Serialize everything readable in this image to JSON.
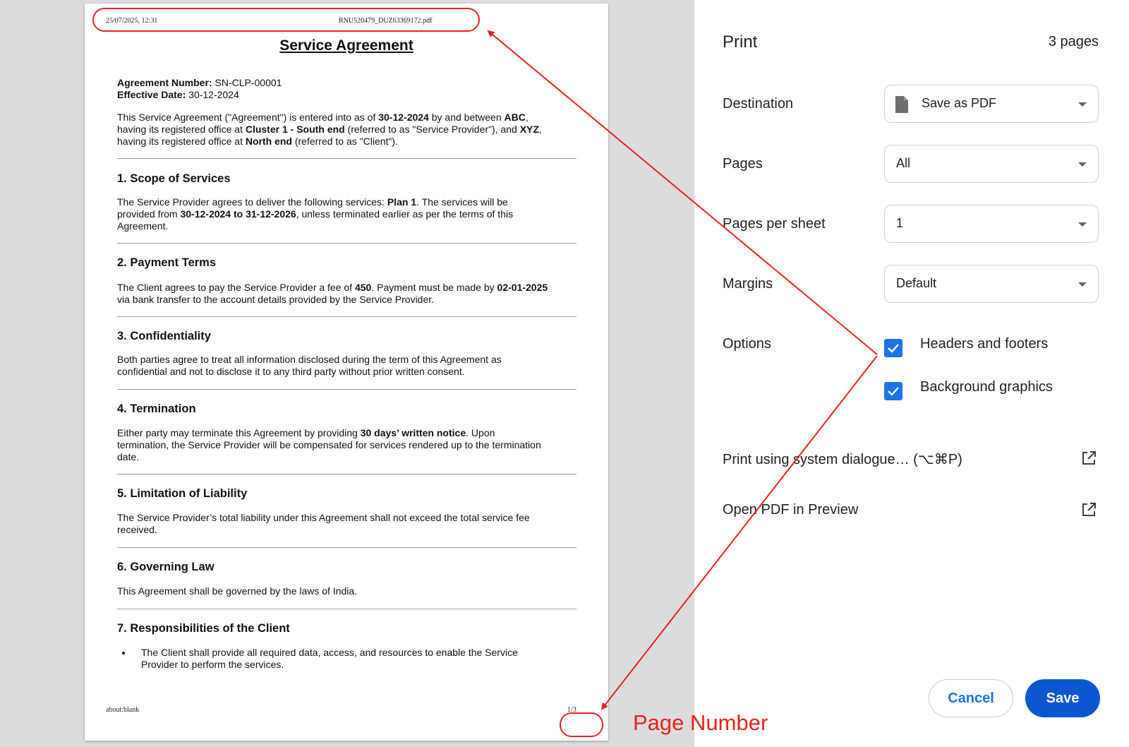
{
  "preview": {
    "header_date": "25/07/2025, 12:31",
    "header_file": "RNU520479_DUZ63369172.pdf",
    "footer_url": "about:blank",
    "footer_page": "1/3",
    "title": "Service Agreement",
    "agreement_number_label": "Agreement Number:",
    "agreement_number": "SN-CLP-00001",
    "effective_date_label": "Effective Date:",
    "effective_date": "30-12-2024",
    "intro": {
      "t1": "This Service Agreement (\"Agreement\") is entered into as of ",
      "b1": "30-12-2024",
      "t2": " by and between ",
      "b2": "ABC",
      "t3": ",",
      "t4": "having its registered office at ",
      "b3": "Cluster 1 - South end",
      "t5": " (referred to as \"Service Provider\"), and ",
      "b4": "XYZ",
      "t6": ",",
      "t7": "having its registered office at ",
      "b5": "North end",
      "t8": " (referred to as \"Client\")."
    },
    "sections": {
      "s1": {
        "heading": "1. Scope of Services",
        "t1": "The Service Provider agrees to deliver the following services: ",
        "b1": "Plan 1",
        "t2": ". The services will be",
        "t3": "provided from ",
        "b2": "30-12-2024 to 31-12-2026",
        "t4": ", unless terminated earlier as per the terms of this",
        "t5": "Agreement."
      },
      "s2": {
        "heading": "2. Payment Terms",
        "t1": "The Client agrees to pay the Service Provider a fee of ",
        "b1": "450",
        "t2": ". Payment must be made by ",
        "b2": "02-01-2025",
        "t3": "via bank transfer to the account details provided by the Service Provider."
      },
      "s3": {
        "heading": "3. Confidentiality",
        "line1": "Both parties agree to treat all information disclosed during the term of this Agreement as",
        "line2": "confidential and not to disclose it to any third party without prior written consent."
      },
      "s4": {
        "heading": "4. Termination",
        "t1": "Either party may terminate this Agreement by providing ",
        "b1": "30 days’ written notice",
        "t2": ". Upon",
        "line2": "termination, the Service Provider will be compensated for services rendered up to the termination",
        "line3": "date."
      },
      "s5": {
        "heading": "5. Limitation of Liability",
        "line1": "The Service Provider’s total liability under this Agreement shall not exceed the total service fee",
        "line2": "received."
      },
      "s6": {
        "heading": "6. Governing Law",
        "line1": "This Agreement shall be governed by the laws of India."
      },
      "s7": {
        "heading": "7. Responsibilities of the Client",
        "bullet1_line1": "The Client shall provide all required data, access, and resources to enable the Service",
        "bullet1_line2": "Provider to perform the services."
      }
    }
  },
  "settings": {
    "title": "Print",
    "page_count": "3 pages",
    "destination": {
      "label": "Destination",
      "value": "Save as PDF",
      "icon": "document-icon"
    },
    "pages": {
      "label": "Pages",
      "value": "All"
    },
    "pages_per_sheet": {
      "label": "Pages per sheet",
      "value": "1"
    },
    "margins": {
      "label": "Margins",
      "value": "Default"
    },
    "options": {
      "label": "Options",
      "headers_footers": {
        "label": "Headers and footers",
        "checked": true
      },
      "background_graphics": {
        "label": "Background graphics",
        "checked": true
      }
    },
    "system_dialog": "Print using system dialogue… (⌥⌘P)",
    "open_preview": "Open PDF in Preview",
    "cancel": "Cancel",
    "save": "Save",
    "accent_color": "#1a73e8",
    "save_button_color": "#0b57d0"
  },
  "annotation": {
    "label": "Page Number",
    "color": "#e8231a"
  }
}
